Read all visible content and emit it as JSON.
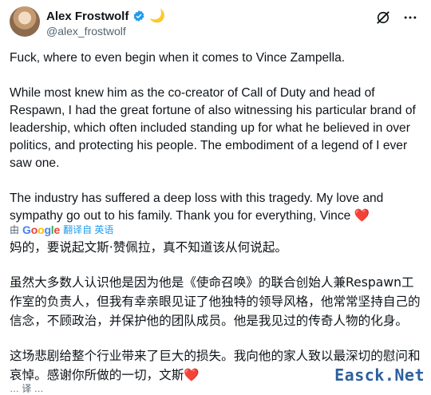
{
  "author": {
    "name": "Alex Frostwolf",
    "emoji": "🌙",
    "handle": "@alex_frostwolf"
  },
  "tweet": {
    "paragraphs": [
      "Fuck, where to even begin when it comes to Vince Zampella.",
      "While most knew him as the co-creator of Call of Duty and head of Respawn, I had the great fortune of also witnessing his particular brand of leadership, which often included standing up for what he believed in over politics, and protecting his people. The embodiment of a legend of I ever saw one.",
      "The industry has suffered a deep loss with this tragedy. My love and sympathy go out to his family. Thank you for everything, Vince"
    ],
    "heart": "❤️"
  },
  "translation_bar": {
    "prefix": "由",
    "provider": "Google",
    "label": "翻译自 英语"
  },
  "translation": {
    "paragraphs": [
      "妈的，要说起文斯·赞佩拉，真不知道该从何说起。",
      "虽然大多数人认识他是因为他是《使命召唤》的联合创始人兼Respawn工作室的负责人，但我有幸亲眼见证了他独特的领导风格，他常常坚持自己的信念，不顾政治，并保护他的团队成员。他是我见过的传奇人物的化身。",
      "这场悲剧给整个行业带来了巨大的损失。我向他的家人致以最深切的慰问和哀悼。感谢你所做的一切，文斯"
    ],
    "heart": "❤️"
  },
  "bottom_cut_text": "… 译 …",
  "watermark": "Easck.Net",
  "colors": {
    "verified": "#1d9bf0",
    "link": "#1d9bf0",
    "heart": "#e0245e",
    "watermark": "#2c5f9e"
  },
  "icons": [
    "verified-badge-icon",
    "grok-icon",
    "more-icon"
  ]
}
